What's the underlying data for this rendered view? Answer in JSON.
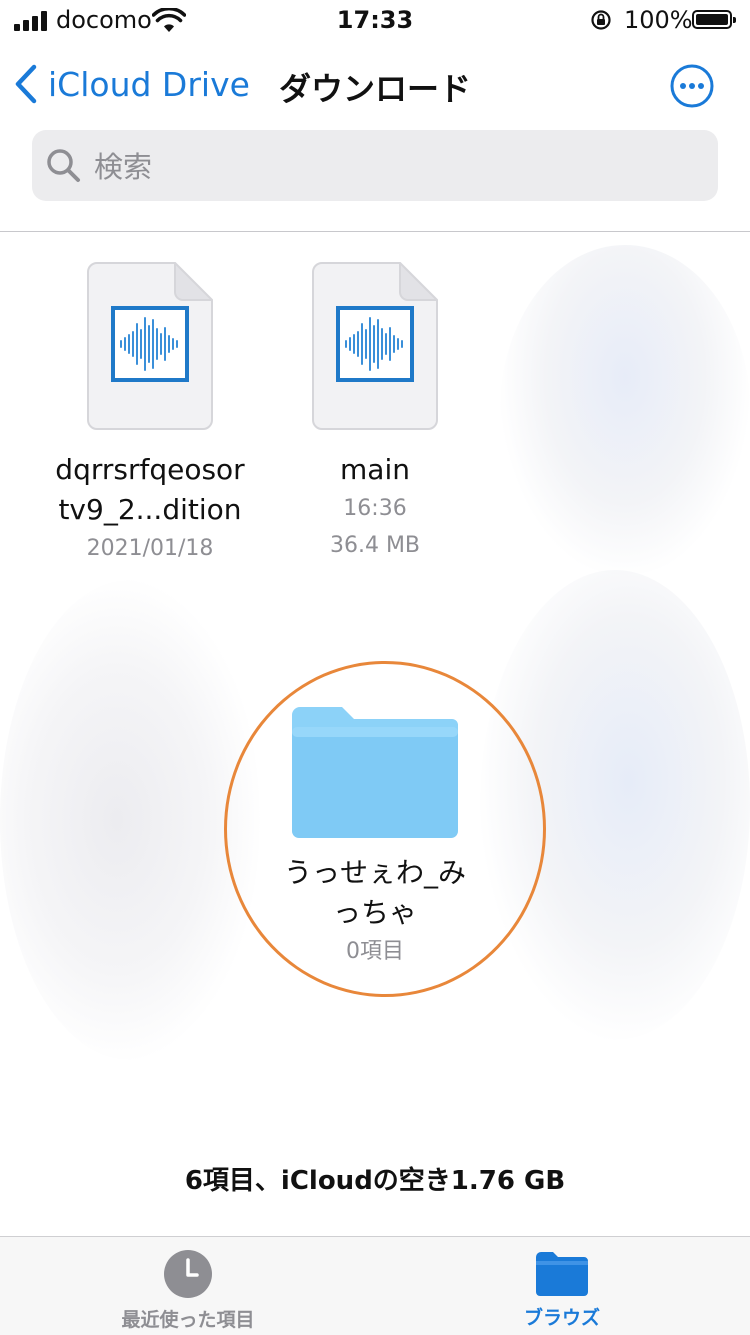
{
  "status_bar": {
    "carrier": "docomo",
    "time": "17:33",
    "battery_percent": "100%"
  },
  "nav": {
    "back_label": "iCloud Drive",
    "title": "ダウンロード"
  },
  "search": {
    "placeholder": "検索"
  },
  "files": [
    {
      "name_line1": "dqrrsrfqeosor",
      "name_line2": "tv9_2...dition",
      "meta1": "2021/01/18",
      "meta2": "",
      "icon": "audio-waveform-icon"
    },
    {
      "name_line1": "main",
      "name_line2": "",
      "meta1": "16:36",
      "meta2": "36.4 MB",
      "icon": "audio-waveform-icon"
    }
  ],
  "folder": {
    "name_line1": "うっせぇわ_み",
    "name_line2": "っちゃ",
    "meta": "0項目",
    "icon": "folder-icon"
  },
  "summary": "6項目、iCloudの空き1.76 GB",
  "tab_bar": {
    "recent_label": "最近使った項目",
    "browse_label": "ブラウズ"
  },
  "colors": {
    "accent": "#1a7ad8",
    "highlight": "#e8873a",
    "folder": "#7fcaf5"
  }
}
